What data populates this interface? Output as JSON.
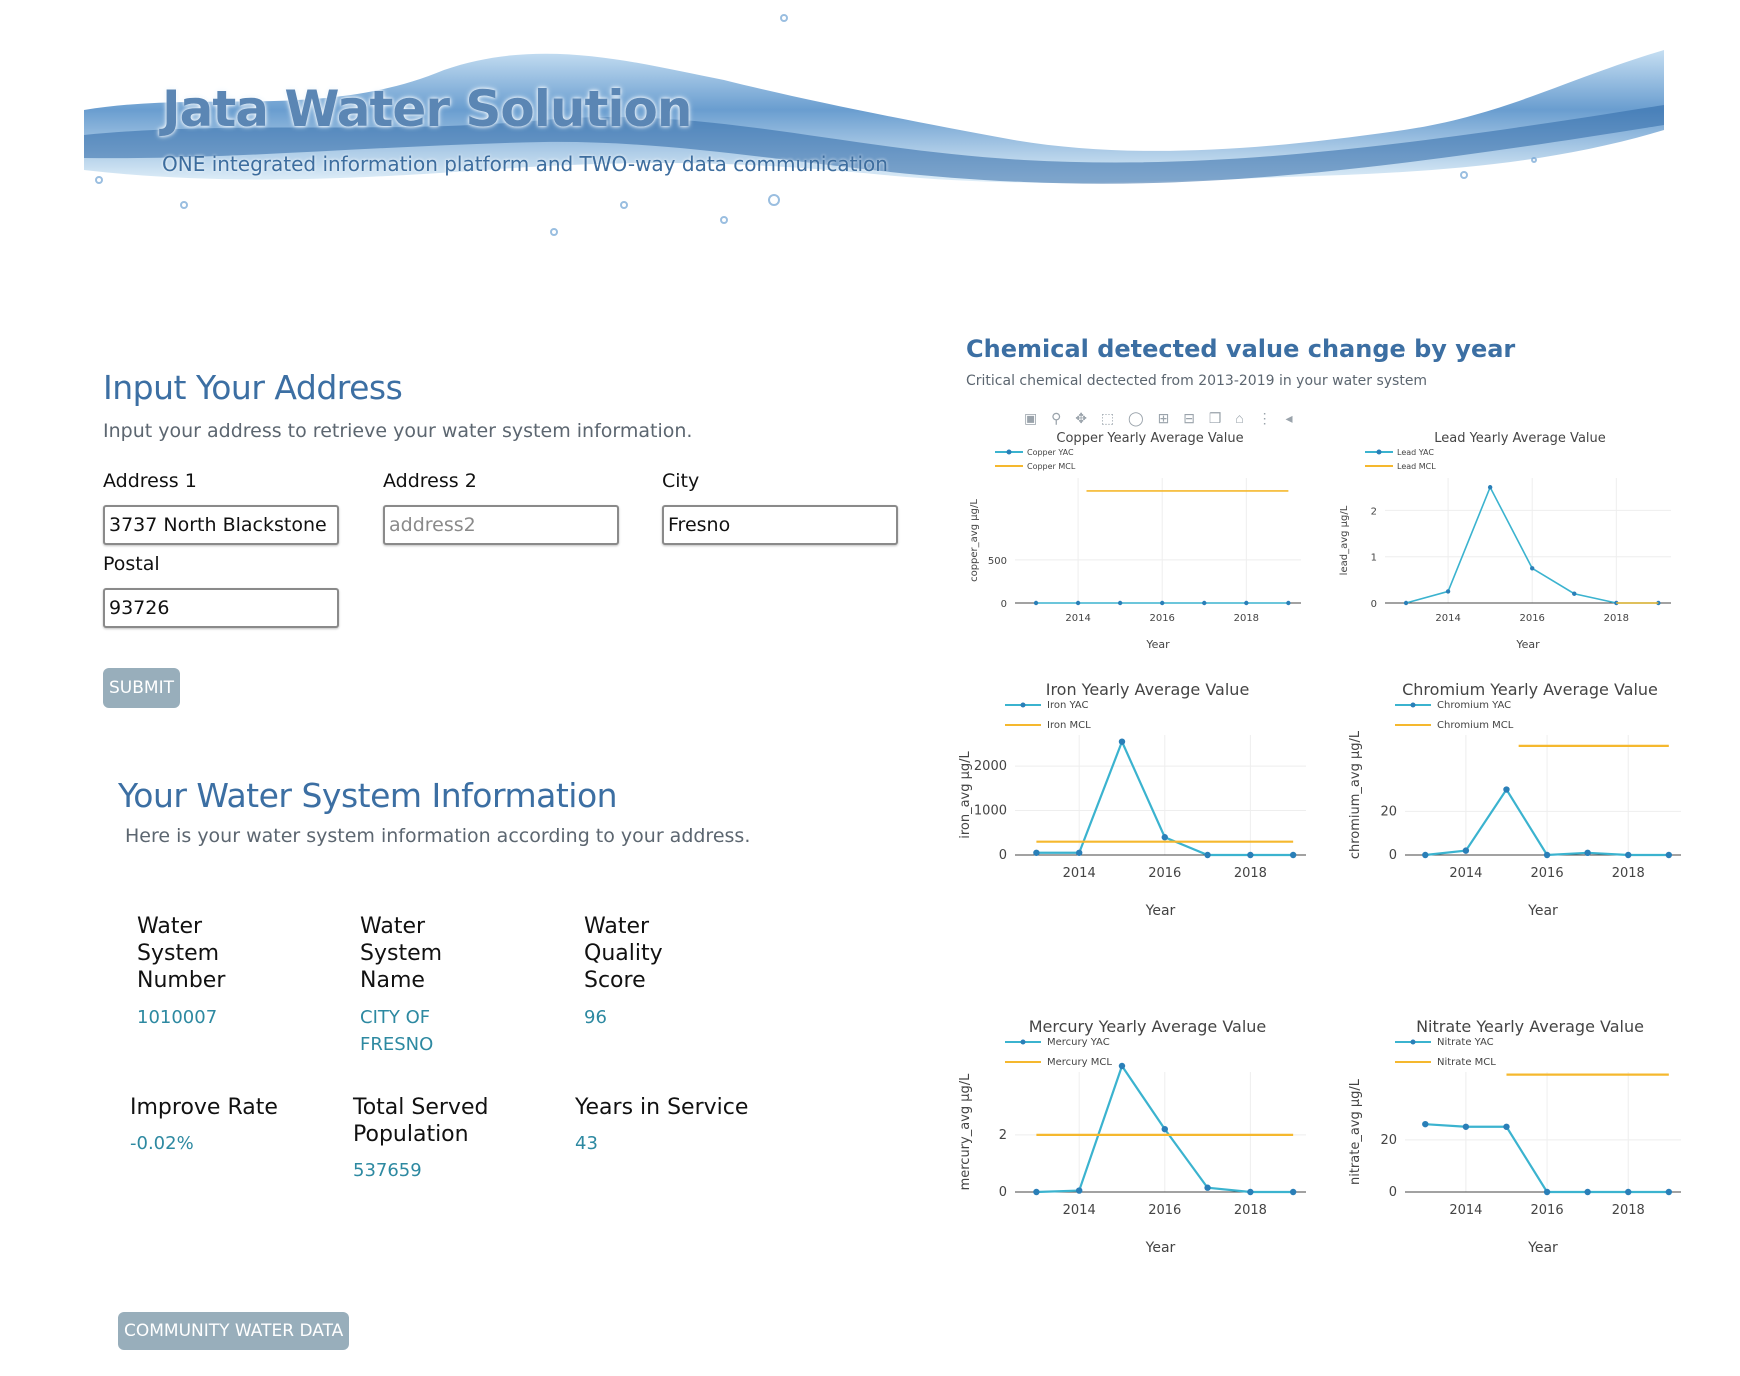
{
  "header": {
    "title": "Jata Water Solution",
    "subtitle": "ONE integrated information platform and TWO-way data communication"
  },
  "address_form": {
    "title": "Input Your Address",
    "description": "Input your address to retrieve your water system information.",
    "address1": {
      "label": "Address 1",
      "value": "3737 North Blackstone",
      "placeholder": ""
    },
    "address2": {
      "label": "Address 2",
      "value": "",
      "placeholder": "address2"
    },
    "city": {
      "label": "City",
      "value": "Fresno",
      "placeholder": ""
    },
    "postal": {
      "label": "Postal",
      "value": "93726",
      "placeholder": ""
    },
    "submit_label": "SUBMIT"
  },
  "water_system": {
    "title": "Your Water System Information",
    "description": "Here is your water system information according to your address.",
    "number": {
      "label": "Water System Number",
      "value": "1010007"
    },
    "name": {
      "label": "Water System Name",
      "value": "CITY OF FRESNO"
    },
    "score": {
      "label": "Water Quality Score",
      "value": "96"
    },
    "improve": {
      "label": "Improve Rate",
      "value": "-0.02%"
    },
    "population": {
      "label": "Total Served Population",
      "value": "537659"
    },
    "years": {
      "label": "Years in Service",
      "value": "43"
    },
    "community_button": "COMMUNITY WATER DATA"
  },
  "charts_section": {
    "title": "Chemical detected value change by year",
    "subtitle": "Critical chemical dectected from 2013-2019 in your water system",
    "toolbar_icons": [
      "camera-icon",
      "zoom-icon",
      "pan-icon",
      "box-select-icon",
      "lasso-select-icon",
      "zoom-in-icon",
      "zoom-out-icon",
      "autoscale-icon",
      "home-icon",
      "spike-lines-icon",
      "collapse-arrow-icon"
    ]
  },
  "colors": {
    "yac": "#3bb3cf",
    "mcl": "#f5b82e",
    "marker": "#2a7fb8",
    "accent": "#3c6fa3"
  },
  "chart_data": [
    {
      "type": "line",
      "title": "Copper Yearly Average Value",
      "xlabel": "Year",
      "ylabel": "copper_avg µg/L",
      "x": [
        2013,
        2014,
        2015,
        2016,
        2017,
        2018,
        2019
      ],
      "xticks": [
        "2014",
        "2016",
        "2018"
      ],
      "yticks": [
        0,
        500
      ],
      "ylim": [
        0,
        1450
      ],
      "legend_position": "top-left",
      "series": [
        {
          "name": "Copper YAC",
          "values": [
            0,
            0,
            0,
            0,
            0,
            0,
            0
          ],
          "markers": true
        },
        {
          "name": "Copper MCL",
          "x": [
            2014.2,
            2019
          ],
          "values": [
            1300,
            1300
          ]
        }
      ]
    },
    {
      "type": "line",
      "title": "Lead  Yearly Average Value",
      "xlabel": "Year",
      "ylabel": "lead_avg µg/L",
      "x": [
        2013,
        2014,
        2015,
        2016,
        2017,
        2018,
        2019
      ],
      "xticks": [
        "2014",
        "2016",
        "2018"
      ],
      "yticks": [
        0,
        1,
        2
      ],
      "ylim": [
        0,
        2.7
      ],
      "legend_position": "top-left",
      "series": [
        {
          "name": "Lead  YAC",
          "values": [
            0,
            0.25,
            2.5,
            0.75,
            0.2,
            0,
            0
          ],
          "markers": true
        },
        {
          "name": "Lead  MCL",
          "x": [
            2018,
            2019
          ],
          "values": [
            0,
            0
          ]
        }
      ]
    },
    {
      "type": "line",
      "title": "Iron Yearly Average Value",
      "xlabel": "Year",
      "ylabel": "iron_avg µg/L",
      "x": [
        2013,
        2014,
        2015,
        2016,
        2017,
        2018,
        2019
      ],
      "xticks": [
        "2014",
        "2016",
        "2018"
      ],
      "yticks": [
        0,
        1000,
        2000
      ],
      "ylim": [
        0,
        2700
      ],
      "legend_position": "top-left",
      "series": [
        {
          "name": "Iron YAC",
          "values": [
            50,
            50,
            2550,
            400,
            0,
            0,
            0
          ],
          "markers": true
        },
        {
          "name": "Iron MCL",
          "x": [
            2013,
            2019
          ],
          "values": [
            300,
            300
          ]
        }
      ]
    },
    {
      "type": "line",
      "title": "Chromium Yearly Average Value",
      "xlabel": "Year",
      "ylabel": "chromium_avg µg/L",
      "x": [
        2013,
        2014,
        2015,
        2016,
        2017,
        2018,
        2019
      ],
      "xticks": [
        "2014",
        "2016",
        "2018"
      ],
      "yticks": [
        0,
        20
      ],
      "ylim": [
        0,
        55
      ],
      "legend_position": "top-left",
      "series": [
        {
          "name": "Chromium YAC",
          "values": [
            0,
            2,
            30,
            0,
            1,
            0,
            0
          ],
          "markers": true
        },
        {
          "name": "Chromium MCL",
          "x": [
            2015.3,
            2019
          ],
          "values": [
            50,
            50
          ]
        }
      ]
    },
    {
      "type": "line",
      "title": "Mercury Yearly Average Value",
      "xlabel": "Year",
      "ylabel": "mercury_avg µg/L",
      "x": [
        2013,
        2014,
        2015,
        2016,
        2017,
        2018,
        2019
      ],
      "xticks": [
        "2014",
        "2016",
        "2018"
      ],
      "yticks": [
        0,
        2
      ],
      "ylim": [
        0,
        4.2
      ],
      "legend_position": "top-left",
      "series": [
        {
          "name": "Mercury YAC",
          "values": [
            0,
            0.05,
            5,
            2.2,
            0.15,
            0,
            0
          ],
          "markers": true
        },
        {
          "name": "Mercury MCL",
          "x": [
            2013,
            2019
          ],
          "values": [
            2,
            2
          ]
        }
      ]
    },
    {
      "type": "line",
      "title": "Nitrate Yearly Average Value",
      "xlabel": "Year",
      "ylabel": "nitrate_avg µg/L",
      "x": [
        2013,
        2014,
        2015,
        2016,
        2017,
        2018,
        2019
      ],
      "xticks": [
        "2014",
        "2016",
        "2018"
      ],
      "yticks": [
        0,
        20
      ],
      "ylim": [
        0,
        46
      ],
      "legend_position": "top-left",
      "series": [
        {
          "name": "Nitrate YAC",
          "values": [
            26,
            25,
            25,
            0,
            0,
            0,
            0
          ],
          "markers": true
        },
        {
          "name": "Nitrate MCL",
          "x": [
            2015,
            2019
          ],
          "values": [
            45,
            45
          ]
        }
      ]
    }
  ]
}
